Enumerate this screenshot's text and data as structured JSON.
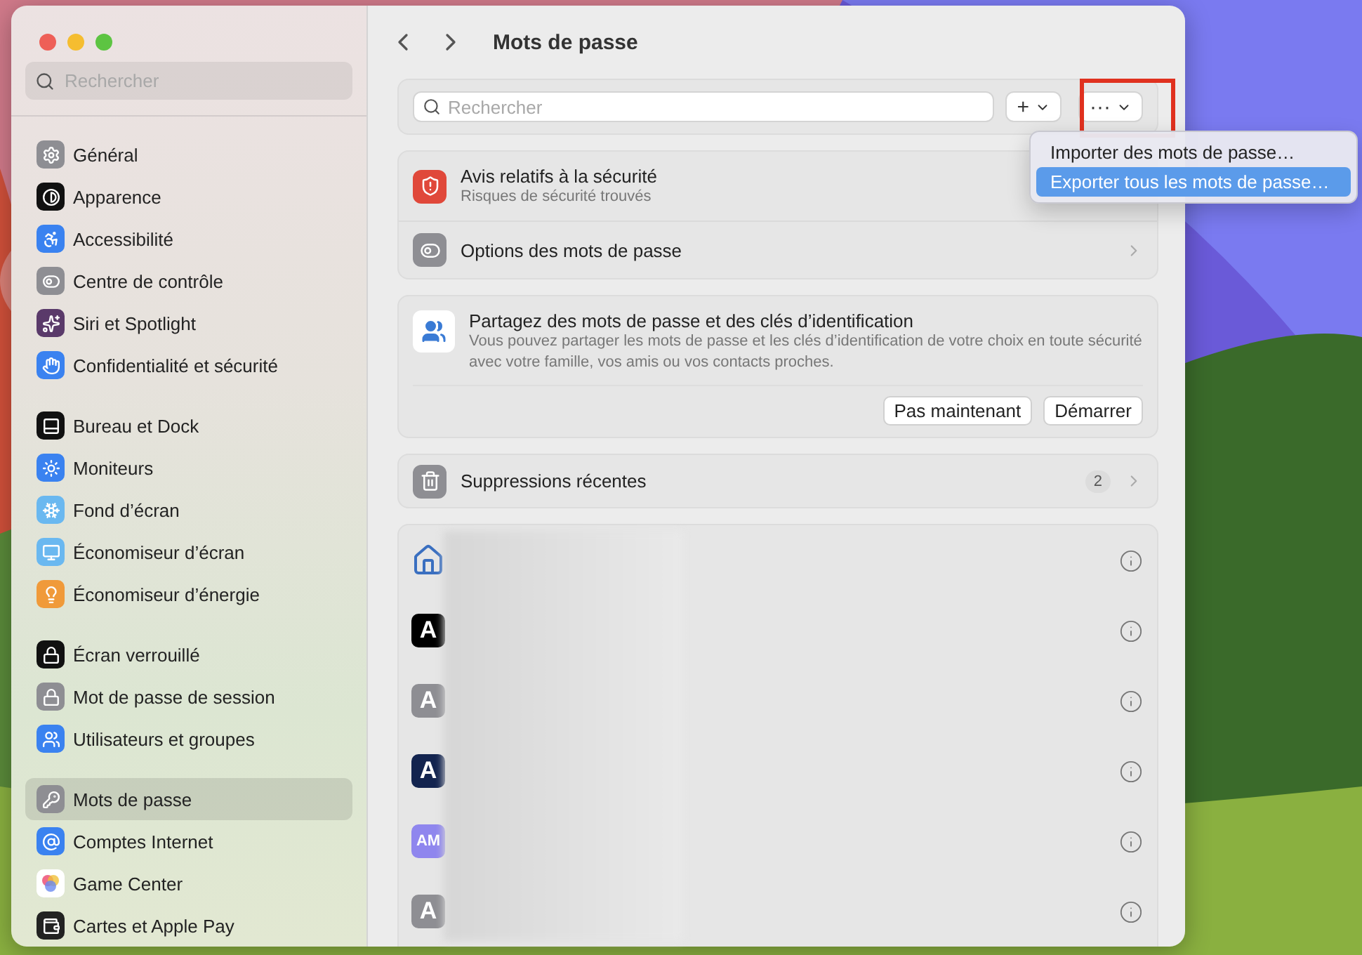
{
  "window": {
    "title": "Mots de passe"
  },
  "sidebar": {
    "search": {
      "placeholder": "Rechercher"
    },
    "groups": [
      {
        "items": [
          {
            "label": "Général",
            "selected": false
          },
          {
            "label": "Apparence",
            "selected": false
          },
          {
            "label": "Accessibilité",
            "selected": false
          },
          {
            "label": "Centre de contrôle",
            "selected": false
          },
          {
            "label": "Siri et Spotlight",
            "selected": false
          },
          {
            "label": "Confidentialité et sécurité",
            "selected": false
          }
        ]
      },
      {
        "items": [
          {
            "label": "Bureau et Dock",
            "selected": false
          },
          {
            "label": "Moniteurs",
            "selected": false
          },
          {
            "label": "Fond d’écran",
            "selected": false
          },
          {
            "label": "Économiseur d’écran",
            "selected": false
          },
          {
            "label": "Économiseur d’énergie",
            "selected": false
          }
        ]
      },
      {
        "items": [
          {
            "label": "Écran verrouillé",
            "selected": false
          },
          {
            "label": "Mot de passe de session",
            "selected": false
          },
          {
            "label": "Utilisateurs et groupes",
            "selected": false
          }
        ]
      },
      {
        "items": [
          {
            "label": "Mots de passe",
            "selected": true
          },
          {
            "label": "Comptes Internet",
            "selected": false
          },
          {
            "label": "Game Center",
            "selected": false
          },
          {
            "label": "Cartes et Apple Pay",
            "selected": false
          }
        ]
      }
    ]
  },
  "toolbar": {
    "search": {
      "placeholder": "Rechercher"
    },
    "add_button": "+",
    "more_button": "···"
  },
  "menu": {
    "items": [
      {
        "label": "Importer des mots de passe…",
        "selected": false
      },
      {
        "label": "Exporter tous les mots de passe…",
        "selected": true
      }
    ]
  },
  "security": {
    "title": "Avis relatifs à la sécurité",
    "subtitle": "Risques de sécurité trouvés"
  },
  "options": {
    "label": "Options des mots de passe"
  },
  "share": {
    "title": "Partagez des mots de passe et des clés d’identification",
    "body": "Vous pouvez partager les mots de passe et les clés d’identification de votre choix en toute sécurité avec votre famille, vos amis ou vos contacts proches.",
    "buttons": [
      "Pas maintenant",
      "Démarrer"
    ]
  },
  "deleted": {
    "label": "Suppressions récentes",
    "count": "2"
  },
  "passwords": [
    {
      "kind": "house"
    },
    {
      "kind": "monogram",
      "monogram": "A",
      "color": "#000000"
    },
    {
      "kind": "monogram",
      "monogram": "A",
      "color": "#8e8e93"
    },
    {
      "kind": "monogram",
      "monogram": "A",
      "color": "#13244f"
    },
    {
      "kind": "monogram",
      "monogram": "AM",
      "color": "#8f86ee"
    },
    {
      "kind": "monogram",
      "monogram": "A",
      "color": "#8e8e93"
    }
  ]
}
